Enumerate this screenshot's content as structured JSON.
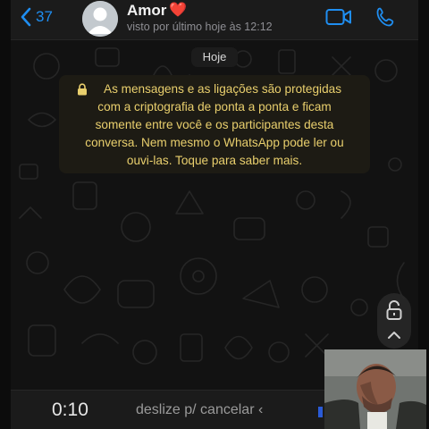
{
  "header": {
    "back_count": "37",
    "contact_name": "Amor",
    "contact_emoji": "❤️",
    "last_seen": "visto por último hoje às 12:12"
  },
  "chat": {
    "date_label": "Hoje",
    "encryption_notice_lines": [
      "As mensagens e as ligações são protegidas",
      "com a criptografia de ponta a ponta e ficam",
      "somente entre você e os participantes desta",
      "conversa. Nem mesmo o WhatsApp pode ler ou",
      "ouvi-las. Toque para saber mais."
    ]
  },
  "recording": {
    "timer": "0:10",
    "slide_to_cancel": "deslize p/ cancelar ‹"
  },
  "colors": {
    "accent": "#1f8ef1",
    "notice_text": "#e9cf6d",
    "background": "#121212"
  },
  "icons": [
    "back-chevron-icon",
    "avatar-icon",
    "video-call-icon",
    "phone-call-icon",
    "lock-icon",
    "padlock-icon",
    "chevron-up-icon"
  ]
}
